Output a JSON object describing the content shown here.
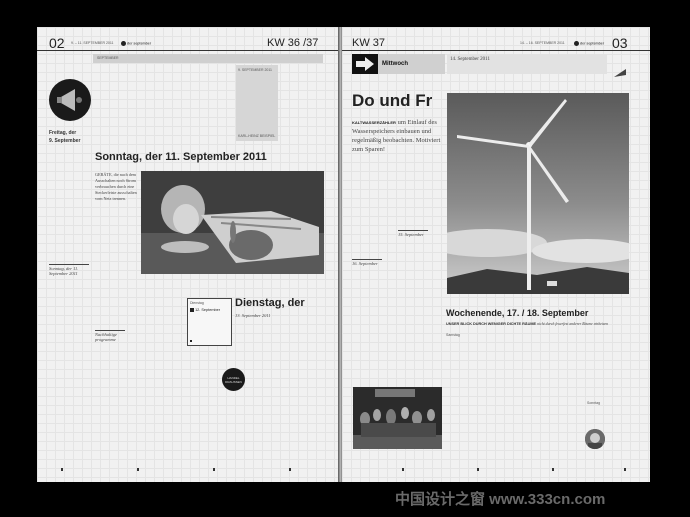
{
  "left_page": {
    "page_number": "02",
    "date_range": "9. – 11. SEPTEMBER 2011",
    "logo_text": "der september",
    "week": "KW 36 /37",
    "top_bar_text": "SEPTEMBER",
    "sidebar_date": "9. SEPTEMBER 2011",
    "sidebar_foot": "KARL-HEINZ BEISPIEL",
    "friday_label": "Freitag, der",
    "friday_date": "9. September",
    "sunday_headline": "Sonntag, der 11. September 2011",
    "sunday_body": "GERÄTE, die nach dem Ausschalten noch Strom verbrauchen durch eine Steckerleiste ausschalten vom Netz trennen.",
    "sunday_caption": "Sonntag, der 11. September 2011",
    "tuesday_box_label": "Dienstag",
    "tuesday_box_date": "12. September",
    "tuesday_headline": "Dienstag, der",
    "tuesday_caption": "13. September 2011",
    "note_caption": "Nachhaltige programme",
    "circle_badge": "HANDEL DRAUSSEN"
  },
  "right_page": {
    "week": "KW 37",
    "date_range": "14. – 16. SEPTEMBER 2011",
    "logo_text": "der september",
    "page_number": "03",
    "day_label": "Mittwoch",
    "day_date": "14. September 2011",
    "headline": "Do und Fr",
    "body_lead": "KALTWASSERZÄHLER",
    "body": "um Einlauf des Wasserspeichers einbauen und regelmäßig beobachten. Motiviert zum Sparen!",
    "caption_1": "15. September",
    "caption_2": "16. September",
    "weekend_headline": "Wochenende, 17. / 18. September",
    "weekend_lead": "UNSER BLICK DURCH WENIGER DICHTE RÄUME",
    "weekend_body": "nicht durch feuerfest anderer Räume einheizen",
    "weekend_caption": "Samstag",
    "sunday_label": "Sonntag"
  },
  "watermark": "中国设计之窗 www.333cn.com",
  "colors": {
    "paper": "#f1f1f1",
    "background": "#000000",
    "ink": "#222222"
  },
  "icons": [
    "arrow-right-icon",
    "megaphone-icon",
    "flag-icon"
  ]
}
